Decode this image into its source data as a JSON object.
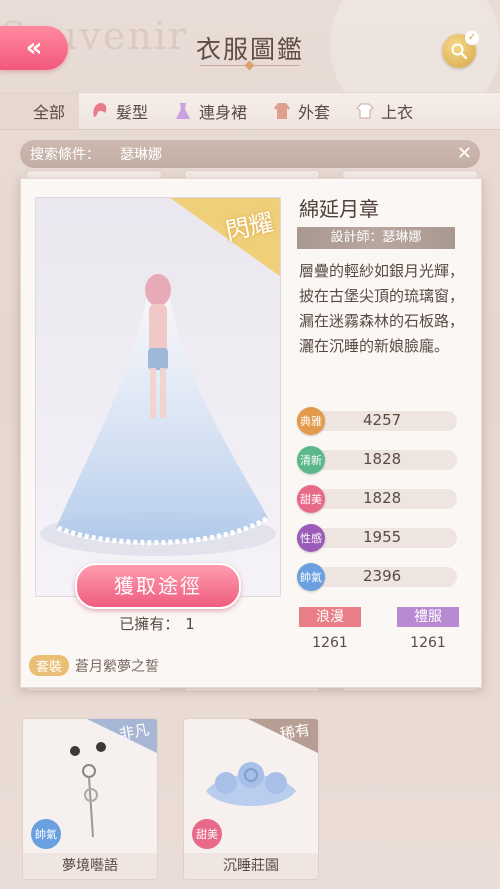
{
  "header": {
    "title": "衣服圖鑑",
    "back_icon": "«"
  },
  "tabs": [
    {
      "label": "全部",
      "icon": "grid-icon"
    },
    {
      "label": "髮型",
      "icon": "hair-icon"
    },
    {
      "label": "連身裙",
      "icon": "dress-icon"
    },
    {
      "label": "外套",
      "icon": "coat-icon"
    },
    {
      "label": "上衣",
      "icon": "top-icon"
    }
  ],
  "search": {
    "label": "搜索條件：",
    "value": "瑟琳娜",
    "clear": "✕"
  },
  "detail": {
    "rarity": "閃耀",
    "name": "綿延月章",
    "designer": "設計師：瑟琳娜",
    "description": "層疊的輕紗如銀月光輝，披在古堡尖頂的琉璃窗，漏在迷霧森林的石板路，灑在沉睡的新娘臉龐。",
    "acquire_label": "獲取途徑",
    "owned_label": "已擁有：",
    "owned_count": "1",
    "set_badge": "套裝",
    "set_name": "蒼月縈夢之誓",
    "attributes": [
      {
        "name": "典雅",
        "value": "4257",
        "color": "#e39a4d"
      },
      {
        "name": "清新",
        "value": "1828",
        "color": "#5cb88a"
      },
      {
        "name": "甜美",
        "value": "1828",
        "color": "#e86a88"
      },
      {
        "name": "性感",
        "value": "1955",
        "color": "#9b5bb8"
      },
      {
        "name": "帥氣",
        "value": "2396",
        "color": "#6aa0e0"
      }
    ],
    "tags": [
      {
        "name": "浪漫",
        "value": "1261",
        "color": "#e97e86"
      },
      {
        "name": "禮服",
        "value": "1261",
        "color": "#b78ad2"
      }
    ]
  },
  "items": [
    {
      "name": "夢境囈語",
      "rarity": "非凡",
      "attribute": "帥氣",
      "attr_color": "#6aa0e0",
      "corner_color": "#a8b6d6"
    },
    {
      "name": "沉睡莊園",
      "rarity": "稀有",
      "attribute": "甜美",
      "attr_color": "#e86a88",
      "corner_color": "#b79d93"
    }
  ]
}
